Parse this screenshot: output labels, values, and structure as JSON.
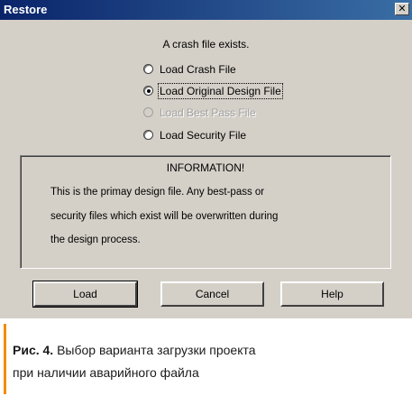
{
  "window": {
    "title": "Restore",
    "close_glyph": "✕"
  },
  "message": "A crash file exists.",
  "options": [
    {
      "label": "Load Crash File",
      "selected": false,
      "enabled": true
    },
    {
      "label": "Load Original Design File",
      "selected": true,
      "enabled": true
    },
    {
      "label": "Load Best Pass File",
      "selected": false,
      "enabled": false
    },
    {
      "label": "Load Security File",
      "selected": false,
      "enabled": true
    }
  ],
  "info": {
    "title": "INFORMATION!",
    "lines": [
      "This is the primay design file. Any best-pass or",
      "security files which exist will be overwritten during",
      "the design process."
    ]
  },
  "buttons": {
    "load": "Load",
    "cancel": "Cancel",
    "help": "Help"
  },
  "caption": {
    "label": "Рис. 4.",
    "line1": "Выбор варианта загрузки проекта",
    "line2": "при наличии аварийного файла"
  },
  "colors": {
    "title_bar": "#0a246a",
    "dialog_bg": "#d4d0c8",
    "caption_accent": "#f28c00"
  }
}
